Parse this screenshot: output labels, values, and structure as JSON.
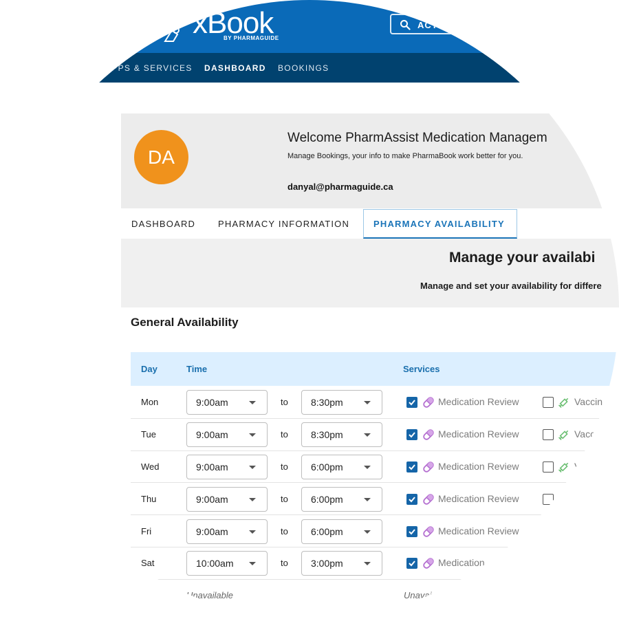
{
  "header": {
    "logo_text": "xBook",
    "logo_sub": "BY PHARMAGUIDE",
    "search_label": "ACT"
  },
  "nav": {
    "items": [
      "APPS & SERVICES",
      "DASHBOARD",
      "BOOKINGS"
    ],
    "active": "DASHBOARD"
  },
  "profile": {
    "initials": "DA",
    "welcome": "Welcome PharmAssist Medication Managem",
    "subtitle": "Manage Bookings, your info to make PharmaBook work better for you.",
    "email": "danyal@pharmaguide.ca",
    "avatar_color": "#f0921c"
  },
  "tabs": {
    "items": [
      "DASHBOARD",
      "PHARMACY INFORMATION",
      "PHARMACY AVAILABILITY"
    ],
    "active": "PHARMACY AVAILABILITY"
  },
  "banner": {
    "title": "Manage your availabi",
    "subtitle": "Manage and set your availability for differe"
  },
  "section": {
    "title": "General Availability"
  },
  "table": {
    "headers": {
      "day": "Day",
      "time": "Time",
      "services": "Services"
    },
    "to_label": "to",
    "rows": [
      {
        "day": "Mon",
        "start": "9:00am",
        "end": "8:30pm",
        "service1": "Medication Review",
        "service1_checked": true,
        "service2": "Vaccin",
        "service2_checked": false
      },
      {
        "day": "Tue",
        "start": "9:00am",
        "end": "8:30pm",
        "service1": "Medication Review",
        "service1_checked": true,
        "service2": "Vacc",
        "service2_checked": false
      },
      {
        "day": "Wed",
        "start": "9:00am",
        "end": "6:00pm",
        "service1": "Medication Review",
        "service1_checked": true,
        "service2": "V",
        "service2_checked": false
      },
      {
        "day": "Thu",
        "start": "9:00am",
        "end": "6:00pm",
        "service1": "Medication Review",
        "service1_checked": true,
        "service2": "",
        "service2_checked": false
      },
      {
        "day": "Fri",
        "start": "9:00am",
        "end": "6:00pm",
        "service1": "Medication Review",
        "service1_checked": true,
        "service2": "",
        "service2_checked": null
      },
      {
        "day": "Sat",
        "start": "10:00am",
        "end": "3:00pm",
        "service1": "Medication",
        "service1_checked": true,
        "service2": "",
        "service2_checked": null
      }
    ],
    "unavailable_time": "Unavailable",
    "unavailable_services": "Unavai"
  },
  "colors": {
    "header_blue": "#0a6ab8",
    "nav_dark": "#01426f",
    "accent_blue": "#1a74b8",
    "checkbox_blue": "#1565a8",
    "pill_purple": "#b46fd0",
    "vaccine_green": "#6cbf73"
  },
  "icons": {
    "search": "search-icon",
    "medication": "pill-icon",
    "vaccine": "syringe-icon",
    "dropdown": "chevron-down-icon",
    "check": "check-icon"
  }
}
